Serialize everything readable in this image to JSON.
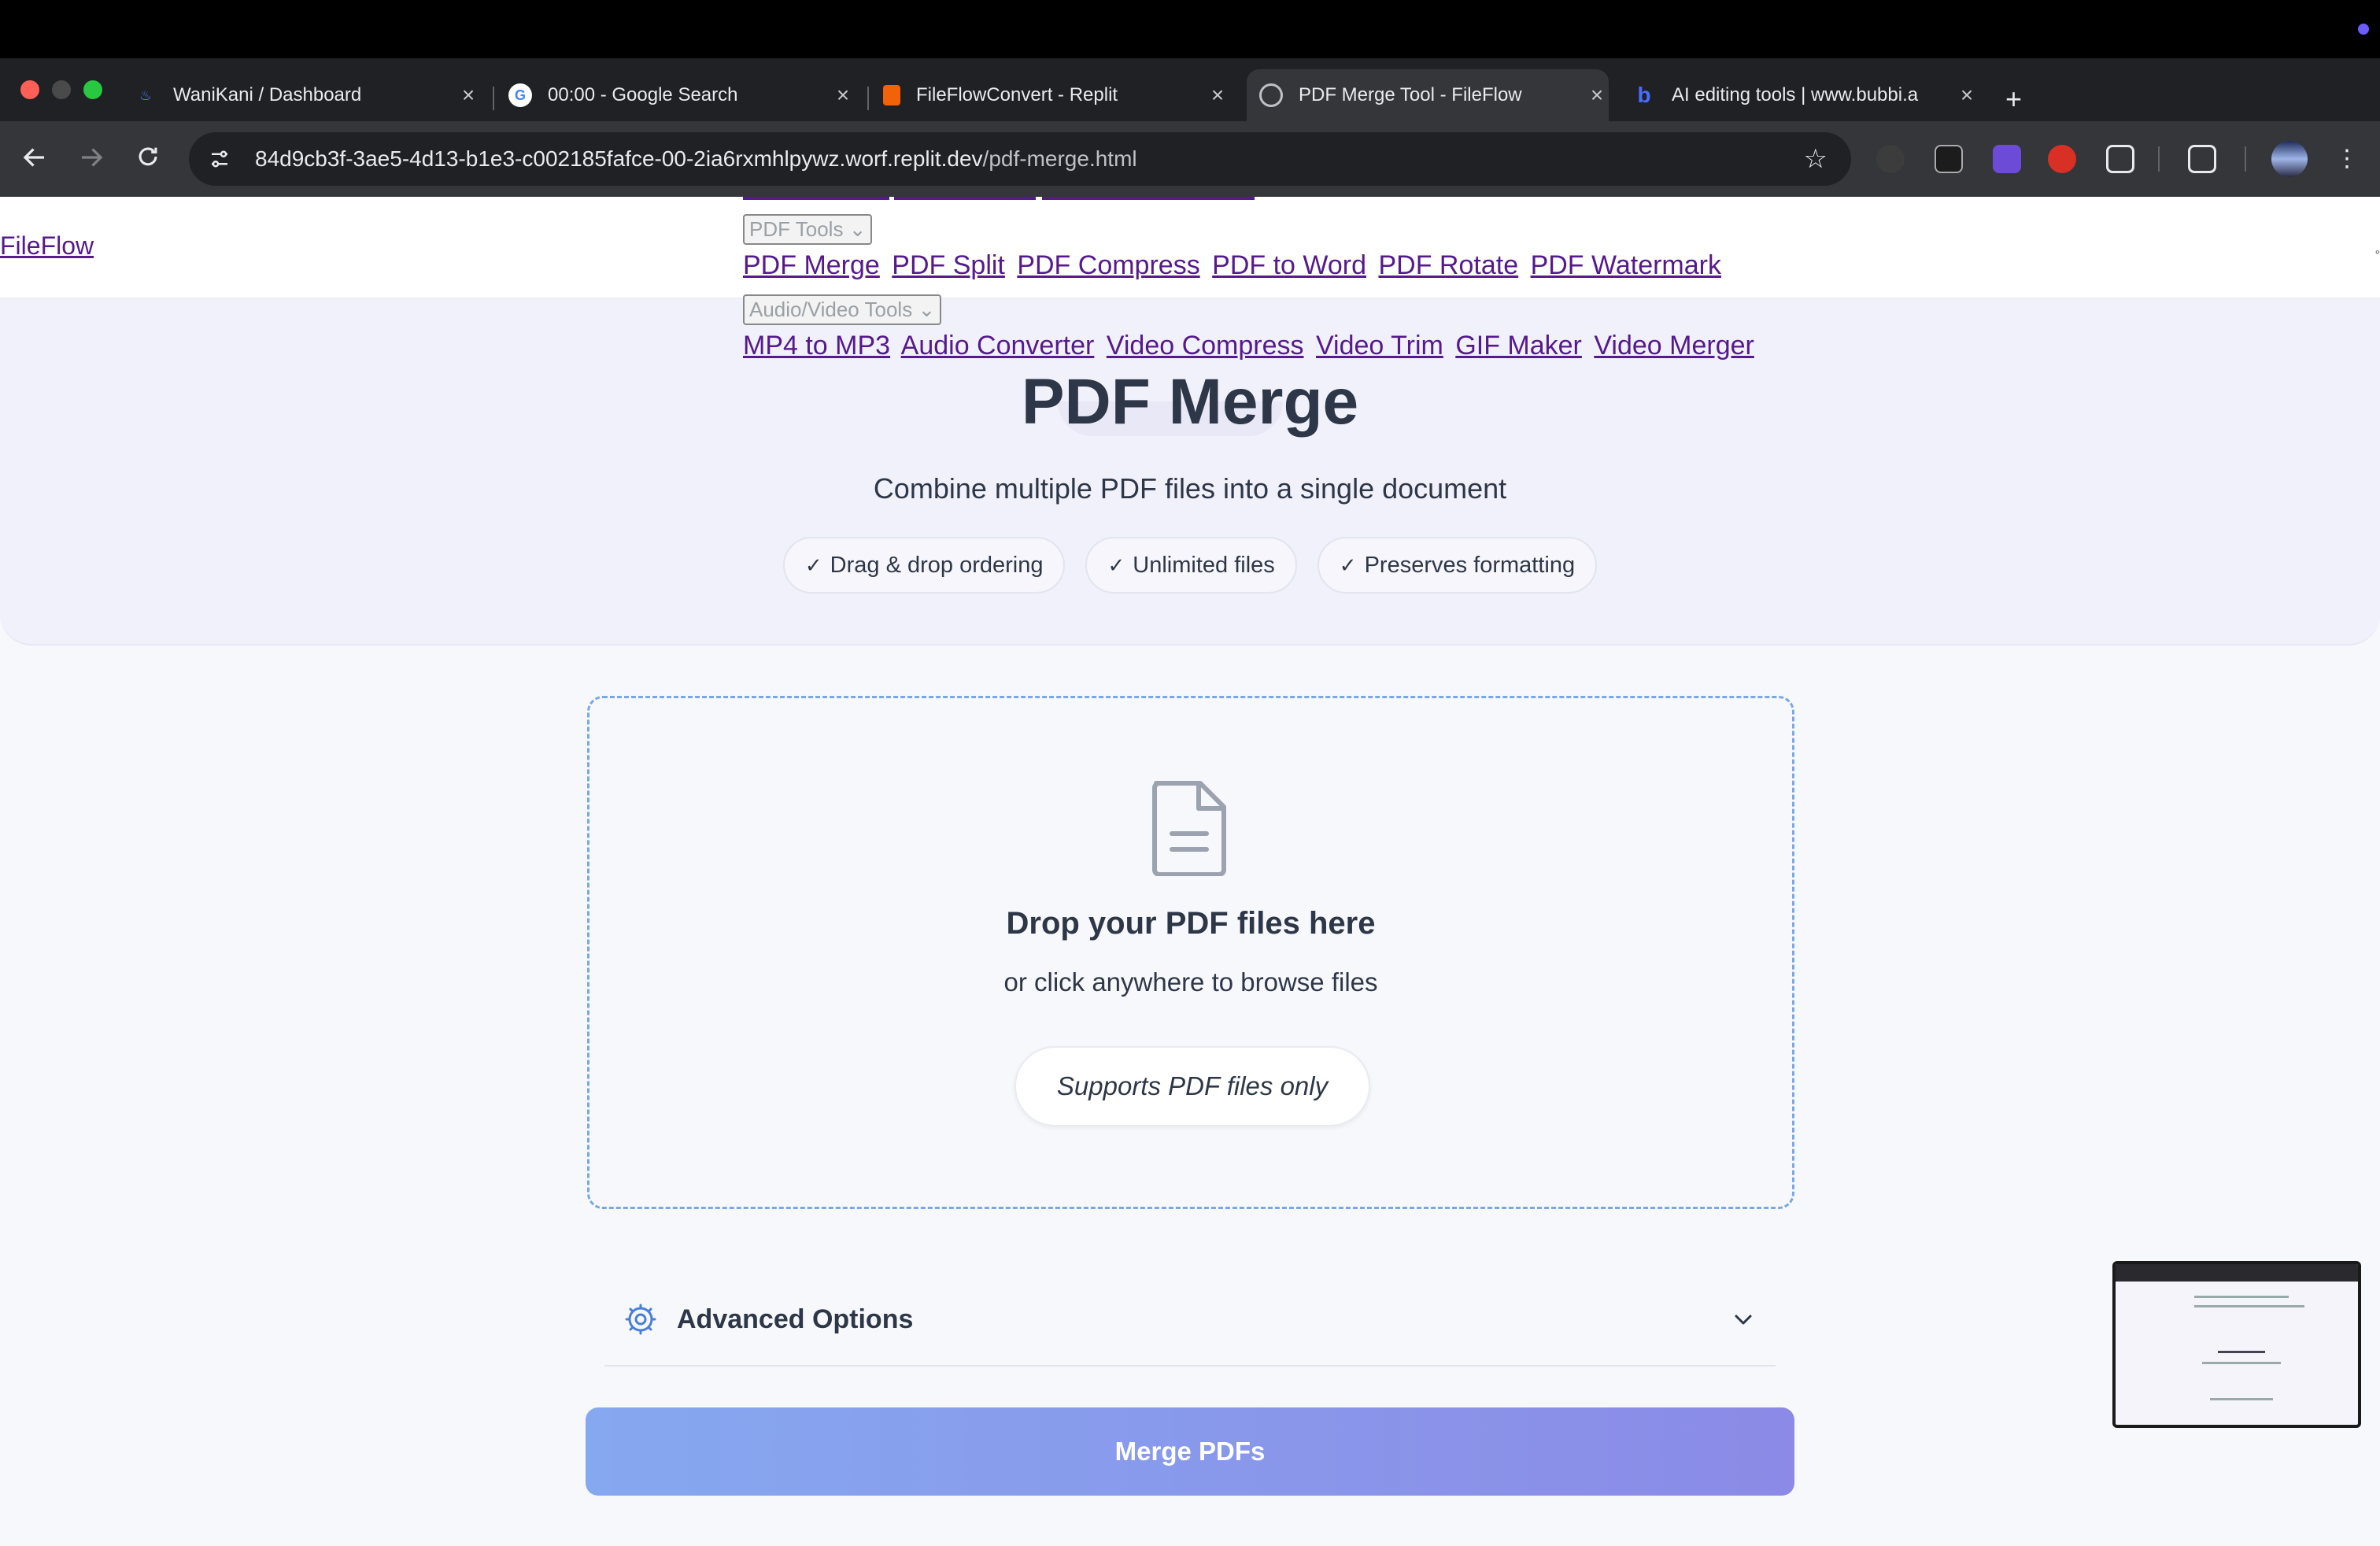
{
  "browser": {
    "tabs": [
      {
        "title": "WaniKani / Dashboard",
        "active": false
      },
      {
        "title": "00:00 - Google Search",
        "active": false
      },
      {
        "title": "FileFlowConvert - Replit",
        "active": false
      },
      {
        "title": "PDF Merge Tool - FileFlow",
        "active": true
      },
      {
        "title": "AI editing tools | www.bubbi.a",
        "active": false
      }
    ],
    "close_glyph": "×",
    "new_tab_glyph": "+",
    "url_host": "84d9cb3f-3ae5-4d13-b1e3-c002185fafce-00-2ia6rxmhlpywz.worf.replit.dev",
    "url_path": "/pdf-merge.html"
  },
  "site": {
    "brand": "FileFlow",
    "nav": {
      "pdf_dropdown": "PDF Tools",
      "pdf_links": [
        "PDF Merge",
        "PDF Split",
        "PDF Compress",
        "PDF to Word",
        "PDF Rotate",
        "PDF Watermark"
      ],
      "av_dropdown": "Audio/Video Tools",
      "av_links": [
        "MP4 to MP3",
        "Audio Converter",
        "Video Compress",
        "Video Trim",
        "GIF Maker",
        "Video Merger"
      ]
    }
  },
  "hero": {
    "title": "PDF Merge",
    "subtitle": "Combine multiple PDF files into a single document",
    "badges": [
      "Drag & drop ordering",
      "Unlimited files",
      "Preserves formatting"
    ]
  },
  "dropzone": {
    "title": "Drop your PDF files here",
    "subtitle": "or click anywhere to browse files",
    "supports": "Supports PDF files only"
  },
  "advanced": {
    "label": "Advanced Options"
  },
  "merge_button": "Merge PDFs",
  "colors": {
    "accent": "#7aa7e6",
    "button_gradient_start": "#86a8f0",
    "button_gradient_end": "#8b8ae6",
    "heading": "#2d3748",
    "link": "#551a8b"
  }
}
